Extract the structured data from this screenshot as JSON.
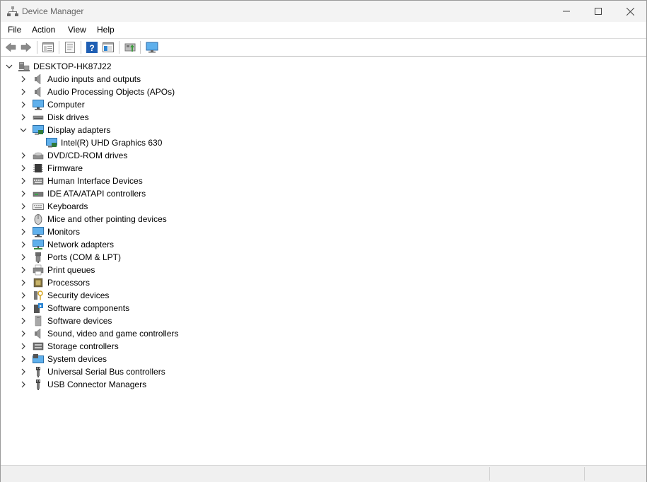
{
  "window": {
    "title": "Device Manager"
  },
  "menu": [
    "File",
    "Action",
    "View",
    "Help"
  ],
  "toolbar": {
    "icons": [
      "back-icon",
      "forward-icon",
      "show-hide-tree-icon",
      "properties-icon",
      "help-icon",
      "view-mode-icon",
      "update-driver-icon",
      "monitor-scan-icon"
    ]
  },
  "tree": {
    "root": "DESKTOP-HK87J22",
    "categories": [
      {
        "label": "Audio inputs and outputs",
        "icon": "speaker-icon"
      },
      {
        "label": "Audio Processing Objects (APOs)",
        "icon": "speaker-icon"
      },
      {
        "label": "Computer",
        "icon": "monitor-icon"
      },
      {
        "label": "Disk drives",
        "icon": "disk-drive-icon"
      },
      {
        "label": "Display adapters",
        "icon": "display-adapter-icon",
        "expanded": true,
        "children": [
          "Intel(R) UHD Graphics 630"
        ]
      },
      {
        "label": "DVD/CD-ROM drives",
        "icon": "dvd-drive-icon"
      },
      {
        "label": "Firmware",
        "icon": "firmware-chip-icon"
      },
      {
        "label": "Human Interface Devices",
        "icon": "hid-icon"
      },
      {
        "label": "IDE ATA/ATAPI controllers",
        "icon": "ide-controller-icon"
      },
      {
        "label": "Keyboards",
        "icon": "keyboard-icon"
      },
      {
        "label": "Mice and other pointing devices",
        "icon": "mouse-icon"
      },
      {
        "label": "Monitors",
        "icon": "monitor-icon"
      },
      {
        "label": "Network adapters",
        "icon": "network-adapter-icon"
      },
      {
        "label": "Ports (COM & LPT)",
        "icon": "port-icon"
      },
      {
        "label": "Print queues",
        "icon": "printer-icon"
      },
      {
        "label": "Processors",
        "icon": "processor-icon"
      },
      {
        "label": "Security devices",
        "icon": "security-key-icon"
      },
      {
        "label": "Software components",
        "icon": "software-component-icon"
      },
      {
        "label": "Software devices",
        "icon": "software-device-icon"
      },
      {
        "label": "Sound, video and game controllers",
        "icon": "speaker-icon"
      },
      {
        "label": "Storage controllers",
        "icon": "storage-controller-icon"
      },
      {
        "label": "System devices",
        "icon": "system-device-icon"
      },
      {
        "label": "Universal Serial Bus controllers",
        "icon": "usb-icon"
      },
      {
        "label": "USB Connector Managers",
        "icon": "usb-icon"
      }
    ]
  },
  "colors": {
    "accent": "#2a84d2",
    "titlebar": "#f3f3f3",
    "statusbar": "#f0f0f0"
  }
}
